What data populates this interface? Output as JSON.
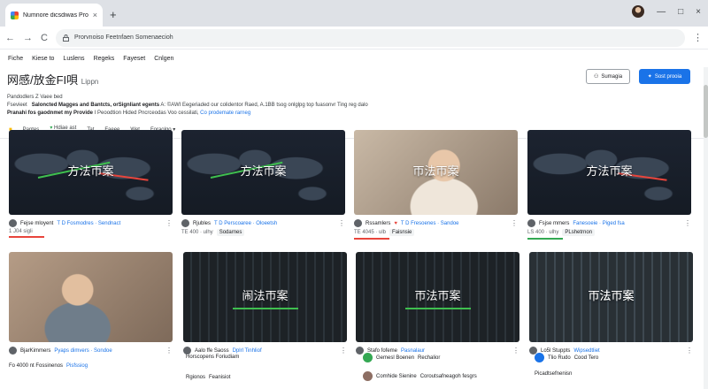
{
  "browser": {
    "tab_title": "Numnore dicsdiwas Pronoels",
    "tab_close": "×",
    "new_tab": "+",
    "url": "Prorvnoiso Feetnfaen Somenaecioh",
    "nav_back": "←",
    "nav_forward": "→",
    "nav_reload": "C",
    "minimize": "—",
    "maximize": "□",
    "close": "×",
    "menu": "⋮"
  },
  "menu": [
    "Fiche",
    "Kiese to",
    "Luslens",
    "Regeks",
    "Fayeset",
    "Cnlgen"
  ],
  "header": {
    "logo": "网感/放金FI唄",
    "logo_sub": "Lippn",
    "btn_outline": "Sumagia",
    "btn_primary": "Sost prooia"
  },
  "description": {
    "line1": "Pandodlers  Z  Vaee bed",
    "line2_label": "Fsevieet",
    "line2_strong": "Saloncted Magges and Bantcts, orSignliant egents",
    "line2_rest": "A: ©AWI Eegeriaded our colidentor Raed, A.1BB tsog onlglpg top fuasonvr Ting reg dalo",
    "line3_label": "Pranahi fos gaodnmet my Provide",
    "line3_rest": "I Peoodtion Hided Pncrceodas Voo cessilati,",
    "line3_link": "Co prodemate rarneg"
  },
  "filters": {
    "f1": "Pantes",
    "f2": "Hdiae ast",
    "f3": "Tat",
    "f4": "Faeee",
    "f5": "Wet",
    "f6": "Foraolgo"
  },
  "cards": [
    {
      "caption": "方法帀案",
      "author": "Fejse mloyent",
      "meta_blue": "T D Fosmodres · Sendnact",
      "sub": "1 J04 sigli"
    },
    {
      "caption": "方法帀案",
      "author": "Rjubles",
      "meta_blue": "T D Perscoaree · Oloeetsh",
      "sub": "TE 400 · ulhy",
      "sub_tag": "Sodarnes"
    },
    {
      "caption": "帀法帀案",
      "author": "Rssamlers",
      "meta_blue": "T D Fresoenes · Sandoe",
      "sub": "TE 4045 · ulb",
      "sub_tag": "Faisnsie"
    },
    {
      "caption": "方法帀案",
      "author": "Fsjse mmers",
      "meta_blue": "Fanesoeie · Piged fsa",
      "sub": "LS 400 · ulhy",
      "sub_tag": "PLshetrnon"
    },
    {
      "caption": "",
      "author": "BjarKimmers",
      "meta_blue": "Pyaps dimvers · Sondoe",
      "sub": "Fo 4000 nt Fossinenos",
      "sub_tag": "Pisfssiog"
    },
    {
      "caption": "闹法帀案",
      "author": "Aalo ffe Saoss",
      "meta_blue": "Dplrl Tinhliof",
      "sub": "Horscopens Foriudiam",
      "sub_tag": "Rgionos"
    },
    {
      "caption": "帀法帀案",
      "author": "Stafo fofeme",
      "meta_blue": "Pasnalaur",
      "sub": "Gemesl Boenen",
      "sub_tag": "Rechalior"
    },
    {
      "caption": "帀法帀案",
      "author": "Lo5l Stuppts",
      "meta_blue": "Wipsedtliet",
      "sub": "Tlio Rudo",
      "sub_tag": "Cood Tero"
    }
  ],
  "extras": {
    "row1_left": "Feanisiot",
    "row1_mid": "Comhide Sienine",
    "row2_mid": "Coroutsafneagoh fesgrs",
    "row2_right": "Picadtsefnenisn"
  },
  "icons": {
    "lock": "lock-icon",
    "dots": "more-icon",
    "filter": "filter-icon"
  }
}
